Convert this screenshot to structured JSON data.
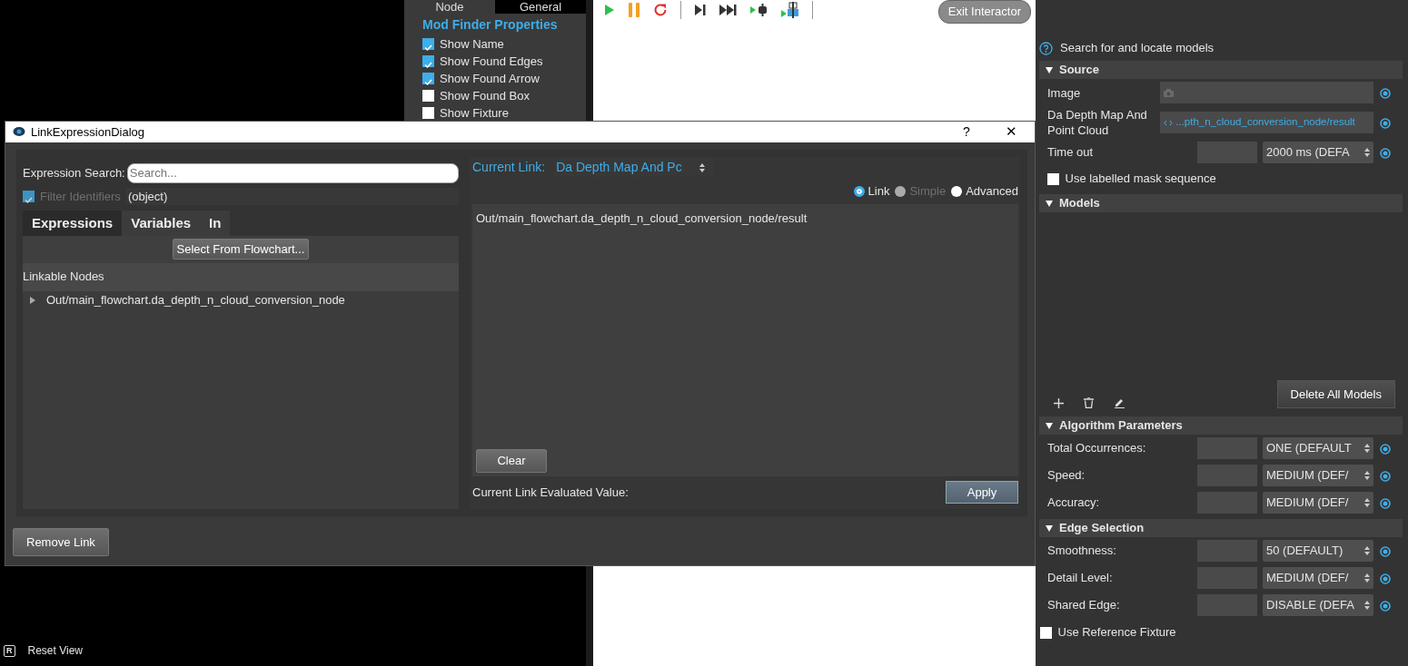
{
  "side_panel": {
    "tabs": [
      {
        "label": "Node",
        "selected": false
      },
      {
        "label": "General",
        "selected": true
      }
    ],
    "title": "Mod Finder Properties",
    "options": [
      {
        "label": "Show Name",
        "checked": true
      },
      {
        "label": "Show Found Edges",
        "checked": true
      },
      {
        "label": "Show Found Arrow",
        "checked": true
      },
      {
        "label": "Show Found Box",
        "checked": false
      },
      {
        "label": "Show Fixture",
        "checked": false
      }
    ]
  },
  "canvas": {
    "exit_button": "Exit Interactor"
  },
  "reset_view": {
    "key": "R",
    "label": "Reset View"
  },
  "dialog": {
    "title": "LinkExpressionDialog",
    "help": "?",
    "close": "✕",
    "search": {
      "label": "Expression Search:",
      "placeholder": "Search..."
    },
    "filter": {
      "label": "Filter Identifiers",
      "checked": true,
      "disabled": true,
      "value": "(object)"
    },
    "tabs": [
      {
        "label": "Expressions",
        "selected": true
      },
      {
        "label": "Variables",
        "selected": false
      },
      {
        "label": "In",
        "selected": false
      }
    ],
    "select_button": "Select From Flowchart...",
    "tree_header": "Linkable Nodes",
    "nodes": [
      {
        "label": "Out/main_flowchart.da_depth_n_cloud_conversion_node",
        "expanded": false
      }
    ],
    "current_link": {
      "label": "Current Link:",
      "value": "Da Depth Map And Pc"
    },
    "modes": [
      {
        "label": "Link",
        "selected": true,
        "disabled": false
      },
      {
        "label": "Simple",
        "selected": false,
        "disabled": true
      },
      {
        "label": "Advanced",
        "selected": false,
        "disabled": false
      }
    ],
    "expression": "Out/main_flowchart.da_depth_n_cloud_conversion_node/result",
    "clear_button": "Clear",
    "evaluated_label": "Current Link Evaluated Value:",
    "apply_button": "Apply",
    "remove_button": "Remove Link"
  },
  "properties": {
    "description": "Search for and locate models",
    "sections": [
      {
        "title": "Source",
        "expanded": true,
        "rows": [
          {
            "kind": "image",
            "label": "Image"
          },
          {
            "kind": "link",
            "label": "Da Depth Map And Point Cloud",
            "value": "...pth_n_cloud_conversion_node/result"
          },
          {
            "kind": "spin",
            "label": "Time out",
            "value": "2000 ms (DEFA"
          },
          {
            "kind": "check",
            "label": "Use labelled mask sequence",
            "checked": false
          }
        ]
      },
      {
        "title": "Models",
        "expanded": true,
        "rows": [
          {
            "kind": "models",
            "button": "Delete All Models"
          }
        ]
      },
      {
        "title": "Algorithm Parameters",
        "expanded": true,
        "rows": [
          {
            "kind": "spin",
            "label": "Total Occurrences:",
            "value": "ONE (DEFAULT"
          },
          {
            "kind": "spin",
            "label": "Speed:",
            "value": "MEDIUM (DEF/"
          },
          {
            "kind": "spin",
            "label": "Accuracy:",
            "value": "MEDIUM (DEF/"
          }
        ]
      },
      {
        "title": "Edge Selection",
        "expanded": true,
        "rows": [
          {
            "kind": "spin",
            "label": "Smoothness:",
            "value": "50 (DEFAULT)"
          },
          {
            "kind": "spin",
            "label": "Detail Level:",
            "value": "MEDIUM (DEF/"
          },
          {
            "kind": "spin",
            "label": "Shared Edge:",
            "value": "DISABLE (DEFA"
          }
        ]
      }
    ],
    "footer_check": {
      "label": "Use Reference Fixture",
      "checked": false
    }
  }
}
